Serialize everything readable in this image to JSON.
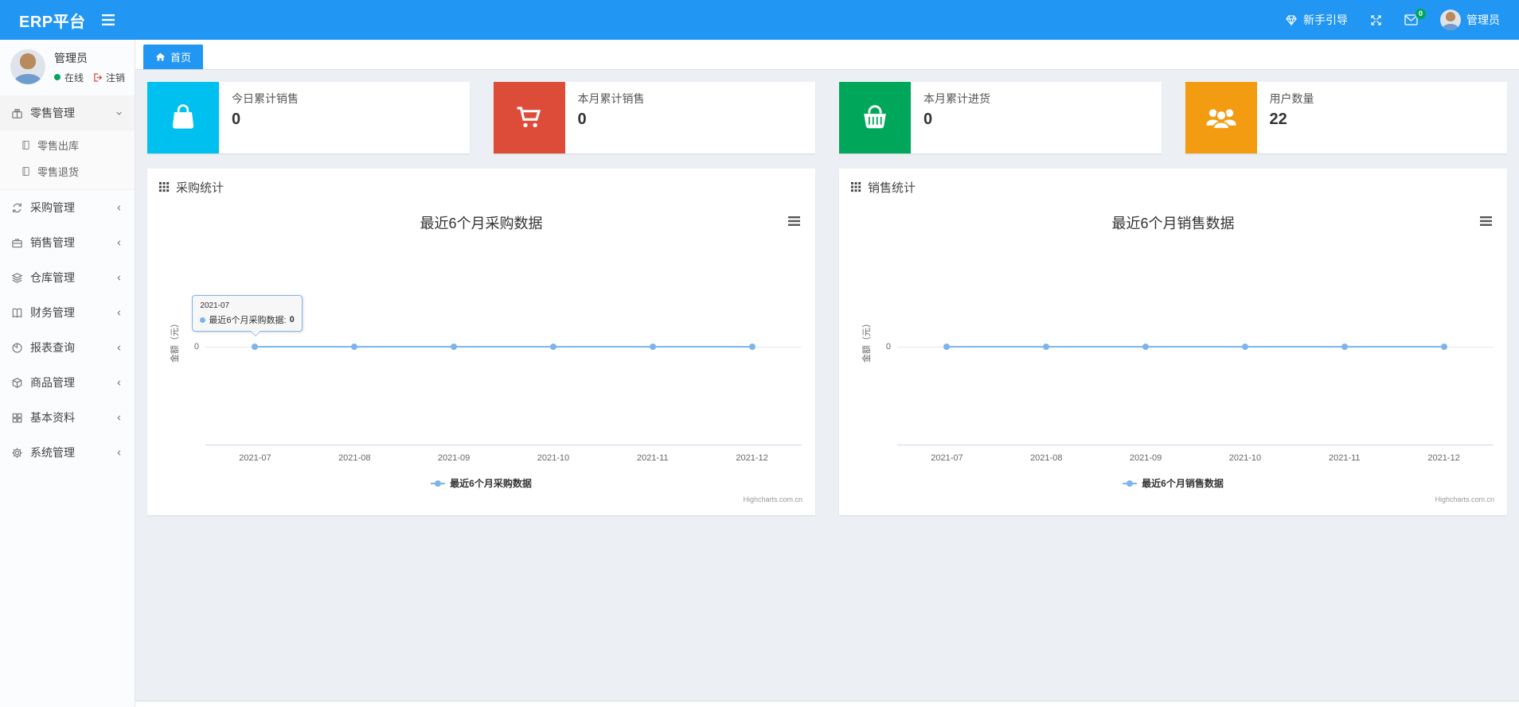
{
  "navbar": {
    "brand": "ERP平台",
    "guide_label": "新手引导",
    "mail_badge": "0",
    "username": "管理员",
    "icons": [
      "menu-icon",
      "gem-icon",
      "fullscreen-icon",
      "envelope-icon",
      "avatar"
    ]
  },
  "sidebar": {
    "user": {
      "name": "管理员",
      "status": "在线",
      "logout_label": "注销"
    },
    "items": [
      {
        "label": "零售管理",
        "icon": "gift-icon",
        "expanded": true,
        "children": [
          {
            "label": "零售出库",
            "icon": "journal-icon"
          },
          {
            "label": "零售退货",
            "icon": "journal-icon"
          }
        ]
      },
      {
        "label": "采购管理",
        "icon": "repeat-icon"
      },
      {
        "label": "销售管理",
        "icon": "briefcase-icon"
      },
      {
        "label": "仓库管理",
        "icon": "layers-icon"
      },
      {
        "label": "财务管理",
        "icon": "open-book-icon"
      },
      {
        "label": "报表查询",
        "icon": "pie-chart-icon"
      },
      {
        "label": "商品管理",
        "icon": "cube-icon"
      },
      {
        "label": "基本资料",
        "icon": "grid-icon"
      },
      {
        "label": "系统管理",
        "icon": "gear-icon"
      }
    ]
  },
  "tabs": {
    "home": "首页"
  },
  "stats": [
    {
      "label": "今日累计销售",
      "value": "0",
      "color": "#00c0ef",
      "icon": "shopping-bag-icon"
    },
    {
      "label": "本月累计销售",
      "value": "0",
      "color": "#dd4b39",
      "icon": "cart-icon"
    },
    {
      "label": "本月累计进货",
      "value": "0",
      "color": "#00a65a",
      "icon": "basket-icon"
    },
    {
      "label": "用户数量",
      "value": "22",
      "color": "#f39c12",
      "icon": "users-icon"
    }
  ],
  "panels": [
    {
      "title": "采购统计",
      "icon": "th-grid-icon"
    },
    {
      "title": "销售统计",
      "icon": "th-grid-icon"
    }
  ],
  "chart_data": [
    {
      "type": "line",
      "title": "最近6个月采购数据",
      "x": [
        "2021-07",
        "2021-08",
        "2021-09",
        "2021-10",
        "2021-11",
        "2021-12"
      ],
      "series": [
        {
          "name": "最近6个月采购数据",
          "values": [
            0,
            0,
            0,
            0,
            0,
            0
          ],
          "color": "#7cb5ec"
        }
      ],
      "ylabel": "金额（元）",
      "yticks": [
        "0"
      ],
      "grid": false,
      "legend_position": "bottom",
      "credits": "Highcharts.com.cn",
      "tooltip": {
        "header": "2021-07",
        "name": "最近6个月采购数据",
        "value": "0",
        "point_index": 0
      }
    },
    {
      "type": "line",
      "title": "最近6个月销售数据",
      "x": [
        "2021-07",
        "2021-08",
        "2021-09",
        "2021-10",
        "2021-11",
        "2021-12"
      ],
      "series": [
        {
          "name": "最近6个月销售数据",
          "values": [
            0,
            0,
            0,
            0,
            0,
            0
          ],
          "color": "#7cb5ec"
        }
      ],
      "ylabel": "金额（元）",
      "yticks": [
        "0"
      ],
      "grid": false,
      "legend_position": "bottom",
      "credits": "Highcharts.com.cn",
      "tooltip": null
    }
  ]
}
